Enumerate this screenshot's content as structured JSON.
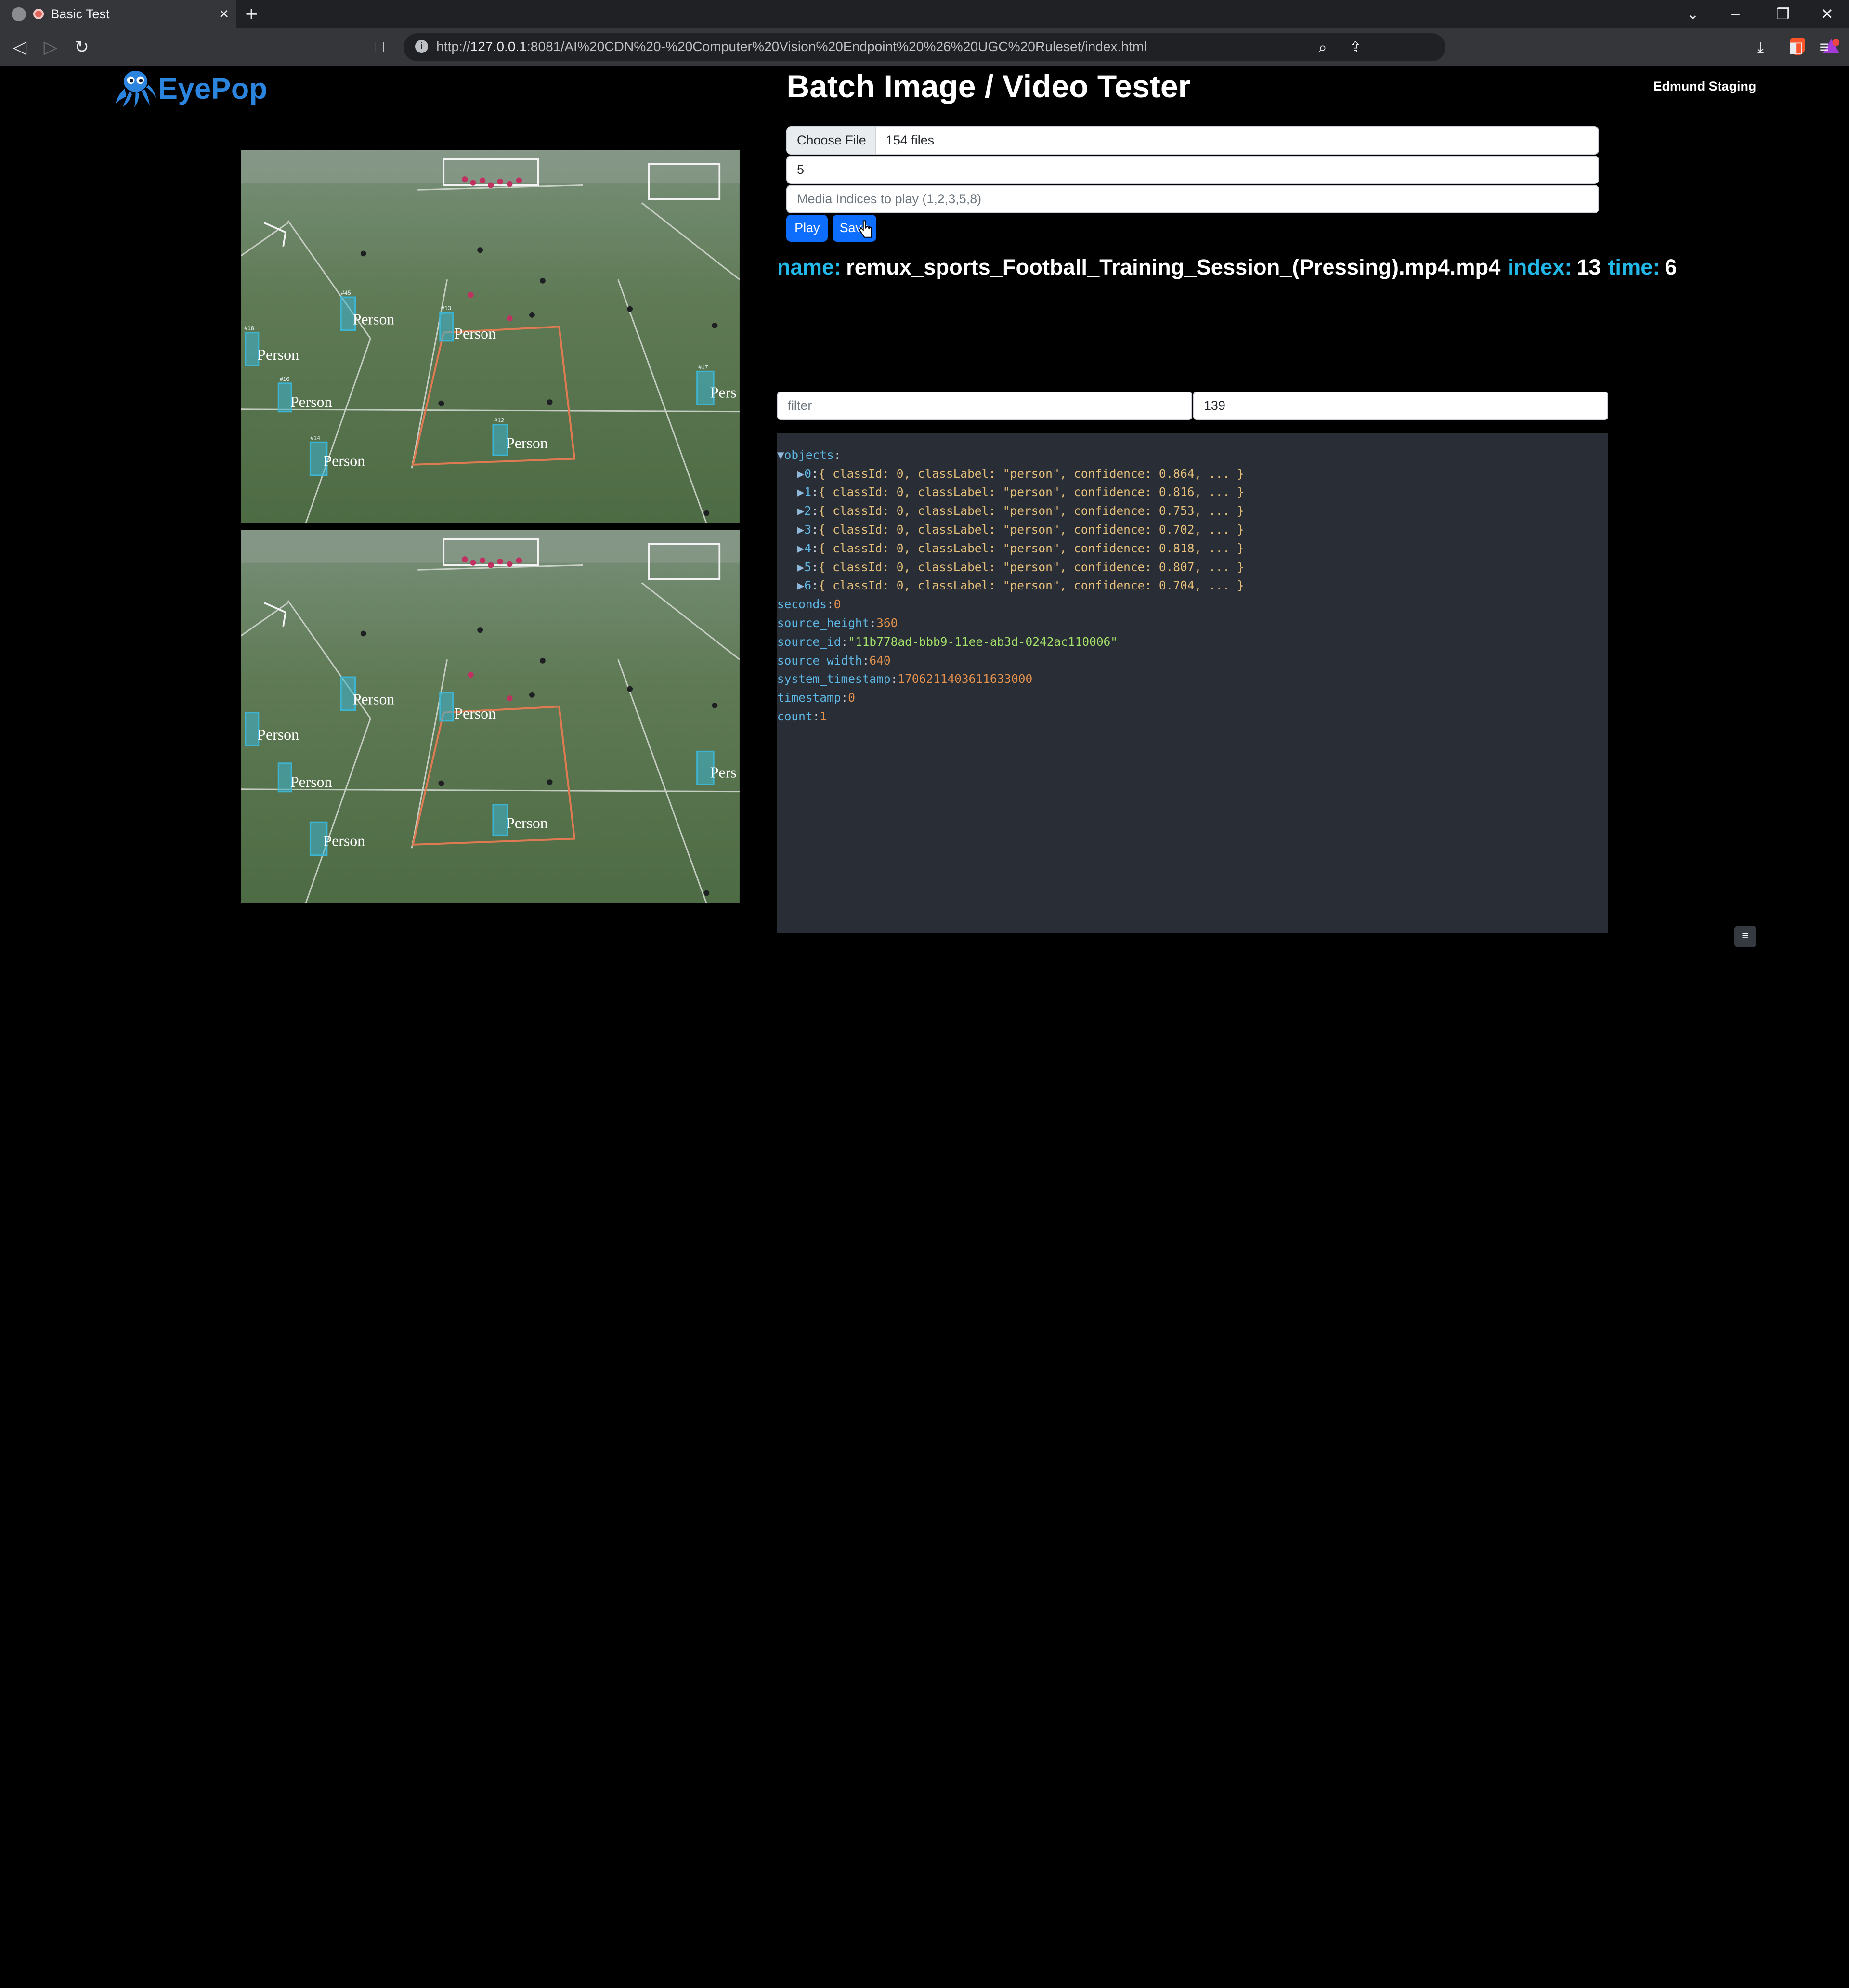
{
  "browser": {
    "tab_title": "Basic Test",
    "url_prefix": "http://",
    "url_host": "127.0.0.1",
    "url_rest": ":8081/AI%20CDN%20-%20Computer%20Vision%20Endpoint%20%26%20UGC%20Ruleset/index.html",
    "icons": [
      "back-icon",
      "forward-icon",
      "reload-icon",
      "bookmark-icon",
      "zoom-icon",
      "share-icon",
      "brave-shields-icon",
      "brave-rewards-icon",
      "download-icon",
      "sidebar-icon",
      "menu-icon"
    ]
  },
  "header": {
    "logo_text": "EyePop",
    "title": "Batch Image / Video Tester",
    "user": "Edmund Staging"
  },
  "controls": {
    "choose_file_label": "Choose File",
    "file_count": "154 files",
    "number_value": "5",
    "indices_placeholder": "Media Indices to play (1,2,3,5,8)",
    "play_label": "Play",
    "save_label": "Save"
  },
  "status": {
    "name_label": "name:",
    "name_value": "remux_sports_Football_Training_Session_(Pressing).mp4.mp4",
    "index_label": "index:",
    "index_value": "13",
    "time_label": "time:",
    "time_value": "6"
  },
  "filter": {
    "placeholder": "filter",
    "value": "139"
  },
  "console": {
    "objects_key": "objects",
    "objects": [
      {
        "idx": "0",
        "summary": "{ classId: 0, classLabel: \"person\", confidence: 0.864, ... }"
      },
      {
        "idx": "1",
        "summary": "{ classId: 0, classLabel: \"person\", confidence: 0.816, ... }"
      },
      {
        "idx": "2",
        "summary": "{ classId: 0, classLabel: \"person\", confidence: 0.753, ... }"
      },
      {
        "idx": "3",
        "summary": "{ classId: 0, classLabel: \"person\", confidence: 0.702, ... }"
      },
      {
        "idx": "4",
        "summary": "{ classId: 0, classLabel: \"person\", confidence: 0.818, ... }"
      },
      {
        "idx": "5",
        "summary": "{ classId: 0, classLabel: \"person\", confidence: 0.807, ... }"
      },
      {
        "idx": "6",
        "summary": "{ classId: 0, classLabel: \"person\", confidence: 0.704, ... }"
      }
    ],
    "fields": [
      {
        "key": "seconds",
        "value": "0",
        "type": "num"
      },
      {
        "key": "source_height",
        "value": "360",
        "type": "num"
      },
      {
        "key": "source_id",
        "value": "\"11b778ad-bbb9-11ee-ab3d-0242ac110006\"",
        "type": "str"
      },
      {
        "key": "source_width",
        "value": "640",
        "type": "num"
      },
      {
        "key": "system_timestamp",
        "value": "1706211403611633000",
        "type": "num"
      },
      {
        "key": "timestamp",
        "value": "0",
        "type": "num"
      },
      {
        "key": "count",
        "value": "1",
        "type": "num"
      }
    ]
  },
  "video_labels": {
    "top": [
      {
        "label": "Person",
        "tag": "#45"
      },
      {
        "label": "Person",
        "tag": "#13"
      },
      {
        "label": "Person",
        "tag": "#18"
      },
      {
        "label": "Person",
        "tag": "#16"
      },
      {
        "label": "Person",
        "tag": "#12"
      },
      {
        "label": "Person",
        "tag": "#14"
      },
      {
        "label": "Pers",
        "tag": "#17"
      }
    ],
    "bottom": [
      {
        "label": "Person"
      },
      {
        "label": "Person"
      },
      {
        "label": "Person"
      },
      {
        "label": "Person"
      },
      {
        "label": "Person"
      },
      {
        "label": "Person"
      },
      {
        "label": "Pers"
      }
    ]
  },
  "scroll_top_label": "≡"
}
